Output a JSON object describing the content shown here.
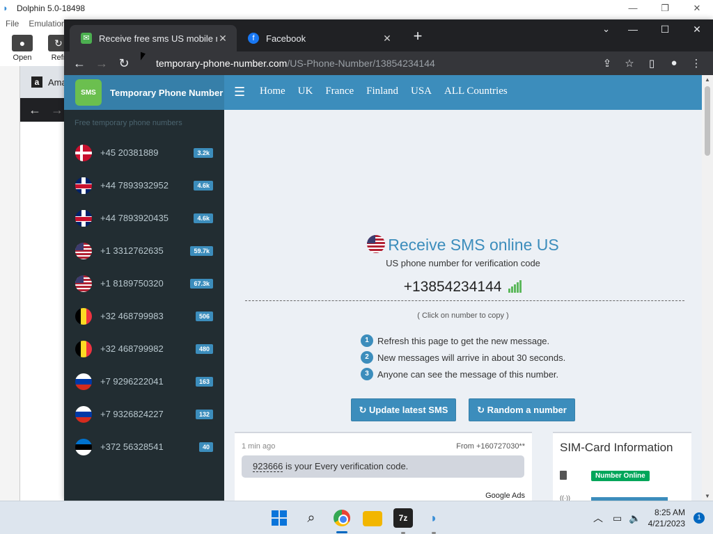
{
  "dolphin": {
    "title": "Dolphin 5.0-18498",
    "menu": [
      "File",
      "Emulation"
    ],
    "toolbar": [
      {
        "label": "Open",
        "icon": "disc-icon"
      },
      {
        "label": "Refr",
        "icon": "refresh-icon"
      }
    ],
    "minimize": "—",
    "maximize": "❐",
    "close": "✕"
  },
  "amazon": {
    "tab_label": "Ama",
    "icon_letter": "a"
  },
  "chrome": {
    "tabs": [
      {
        "title": "Receive free sms US mobile numb",
        "icon": "sms-favicon-icon",
        "active": true
      },
      {
        "title": "Facebook",
        "icon": "facebook-favicon-icon",
        "active": false
      }
    ],
    "new_tab": "+",
    "url_host": "temporary-phone-number.com",
    "url_path": "/US-Phone-Number/13854234144"
  },
  "site": {
    "logo_badge": "SMS",
    "logo_text": "Temporary Phone Number",
    "nav": [
      "Home",
      "UK",
      "France",
      "Finland",
      "USA",
      "ALL Countries"
    ],
    "sidebar_header": "Free temporary phone numbers",
    "numbers": [
      {
        "flag": "dk",
        "number": "+45 20381889",
        "count": "3.2k"
      },
      {
        "flag": "gb",
        "number": "+44 7893932952",
        "count": "4.6k"
      },
      {
        "flag": "gb",
        "number": "+44 7893920435",
        "count": "4.6k"
      },
      {
        "flag": "us",
        "number": "+1 3312762635",
        "count": "59.7k"
      },
      {
        "flag": "us",
        "number": "+1 8189750320",
        "count": "67.3k"
      },
      {
        "flag": "be",
        "number": "+32 468799983",
        "count": "506"
      },
      {
        "flag": "be",
        "number": "+32 468799982",
        "count": "480"
      },
      {
        "flag": "ru",
        "number": "+7 9296222041",
        "count": "163"
      },
      {
        "flag": "ru",
        "number": "+7 9326824227",
        "count": "132"
      },
      {
        "flag": "ee",
        "number": "+372 56328541",
        "count": "40"
      }
    ],
    "heading": "Receive SMS online US",
    "subheading": "US phone number for verification code",
    "phone": "+13854234144",
    "copy_hint": "( Click on number to copy )",
    "steps": [
      {
        "n": "1",
        "text": "Refresh this page to get the new message."
      },
      {
        "n": "2",
        "text": "New messages will arrive in about 30 seconds."
      },
      {
        "n": "3",
        "text": "Anyone can see the message of this number."
      }
    ],
    "btn_update": "↻ Update latest SMS",
    "btn_random": "↻ Random a number",
    "message": {
      "time": "1 min ago",
      "from": "From +160727030**",
      "code": "923666",
      "text": " is your Every verification code.",
      "ads": "Google Ads"
    },
    "sim": {
      "title": "SIM-Card Information",
      "status": "Number Online"
    }
  },
  "taskbar": {
    "time": "8:25 AM",
    "date": "4/21/2023",
    "notifications": "1",
    "seven_zip": "7z"
  }
}
